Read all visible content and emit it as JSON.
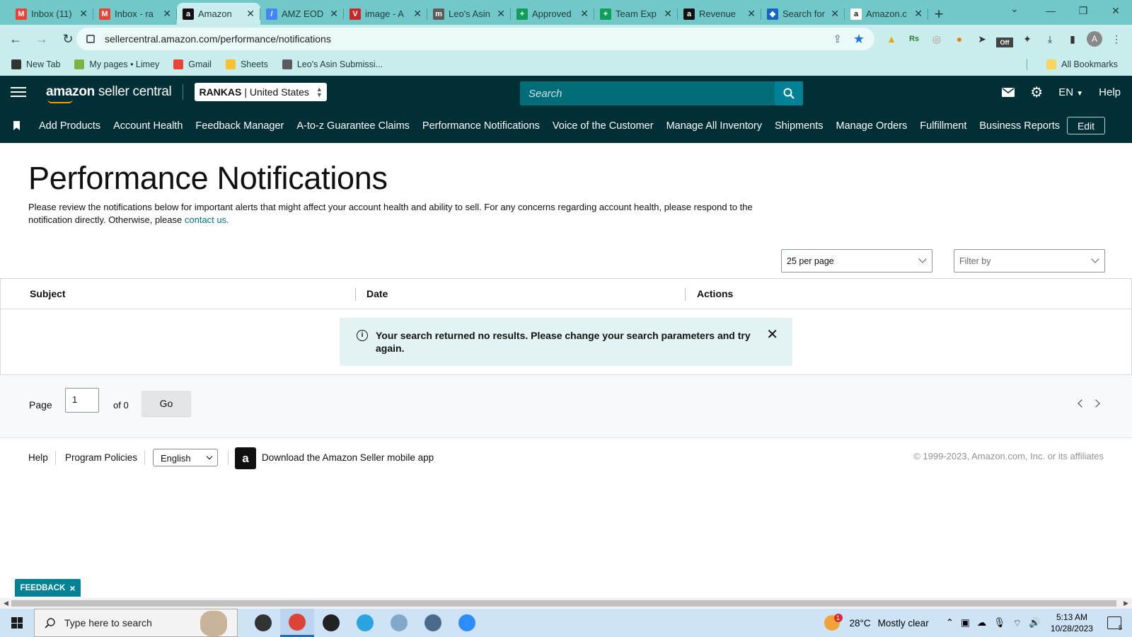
{
  "browser": {
    "tabs": [
      {
        "label": "Inbox (11)",
        "icon": "gmail-icon",
        "color": "#ea4335",
        "glyph": "M"
      },
      {
        "label": "Inbox - ra",
        "icon": "gmail-icon",
        "color": "#ea4335",
        "glyph": "M"
      },
      {
        "label": "Amazon",
        "icon": "amazon-icon",
        "color": "#111111",
        "glyph": "a",
        "active": true
      },
      {
        "label": "AMZ EOD",
        "icon": "pencil-icon",
        "color": "#4285f4",
        "glyph": "/"
      },
      {
        "label": "image - A",
        "icon": "vector-icon",
        "color": "#c62828",
        "glyph": "V"
      },
      {
        "label": "Leo's Asin",
        "icon": "monday-icon",
        "color": "#5b5b5b",
        "glyph": "m"
      },
      {
        "label": "Approved",
        "icon": "sheets-icon",
        "color": "#0f9d58",
        "glyph": "+"
      },
      {
        "label": "Team Exp",
        "icon": "sheets-icon",
        "color": "#0f9d58",
        "glyph": "+"
      },
      {
        "label": "Revenue",
        "icon": "amazon-icon",
        "color": "#111111",
        "glyph": "a"
      },
      {
        "label": "Search for",
        "icon": "diamond-icon",
        "color": "#1565c0",
        "glyph": "◆"
      },
      {
        "label": "Amazon.c",
        "icon": "amazon-icon",
        "color": "#ffffff",
        "glyph": "a"
      }
    ],
    "new_tab": "+",
    "url": "sellercentral.amazon.com/performance/notifications",
    "bookmarks": [
      {
        "label": "New Tab",
        "color": "#333333"
      },
      {
        "label": "My pages • Limey",
        "color": "#7cb342"
      },
      {
        "label": "Gmail",
        "color": "#ea4335"
      },
      {
        "label": "Sheets",
        "color": "#fbc02d"
      },
      {
        "label": "Leo's Asin Submissi...",
        "color": "#5b5b5b"
      }
    ],
    "all_bookmarks": "All Bookmarks",
    "profile_initial": "A",
    "ext_badge": "Off"
  },
  "header": {
    "logo_bold": "amazon",
    "logo_rest": " seller central",
    "account_name": "RANKAS",
    "account_region": "| United States",
    "search_placeholder": "Search",
    "language": "EN",
    "help": "Help"
  },
  "nav": {
    "items": [
      "Add Products",
      "Account Health",
      "Feedback Manager",
      "A-to-z Guarantee Claims",
      "Performance Notifications",
      "Voice of the Customer",
      "Manage All Inventory",
      "Shipments",
      "Manage Orders",
      "Fulfillment",
      "Business Reports"
    ],
    "edit": "Edit"
  },
  "main": {
    "title": "Performance Notifications",
    "description": "Please review the notifications below for important alerts that might affect your account health and ability to sell. For any concerns regarding account health, please respond to the notification directly. Otherwise, please ",
    "contact_link": "contact us.",
    "per_page": "25 per page",
    "filter_placeholder": "Filter by",
    "columns": [
      "Subject",
      "Date",
      "Actions"
    ],
    "alert": "Your search returned no results. Please change your search parameters and try again."
  },
  "pager": {
    "page_label": "Page",
    "page_value": "1",
    "of_label": "of 0",
    "go": "Go"
  },
  "footer": {
    "help": "Help",
    "policies": "Program Policies",
    "language": "English",
    "app_icon_glyph": "a",
    "app": "Download the Amazon Seller mobile app",
    "copyright": "© 1999-2023, Amazon.com, Inc. or its affiliates"
  },
  "feedback": {
    "label": "FEEDBACK",
    "close": "×"
  },
  "taskbar": {
    "search_placeholder": "Type here to search",
    "weather_badge": "1",
    "temperature": "28°C",
    "weather": "Mostly clear",
    "time": "5:13 AM",
    "date": "10/28/2023",
    "notification_count": "5",
    "apps": [
      {
        "name": "task-view-icon",
        "color": "#333333"
      },
      {
        "name": "chrome-icon",
        "color": "#db4437",
        "active": true
      },
      {
        "name": "record-icon",
        "color": "#222222"
      },
      {
        "name": "telegram-icon",
        "color": "#2aa3df"
      },
      {
        "name": "folder-icon",
        "color": "#7fa8c9"
      },
      {
        "name": "calculator-icon",
        "color": "#4a6b8a"
      },
      {
        "name": "zoom-icon",
        "color": "#2d8cff"
      }
    ]
  },
  "colors": {
    "header_bg": "#002f36",
    "search_bg": "#006d79",
    "accent": "#008296",
    "link": "#007185",
    "alert_bg": "#e3f2f3"
  }
}
